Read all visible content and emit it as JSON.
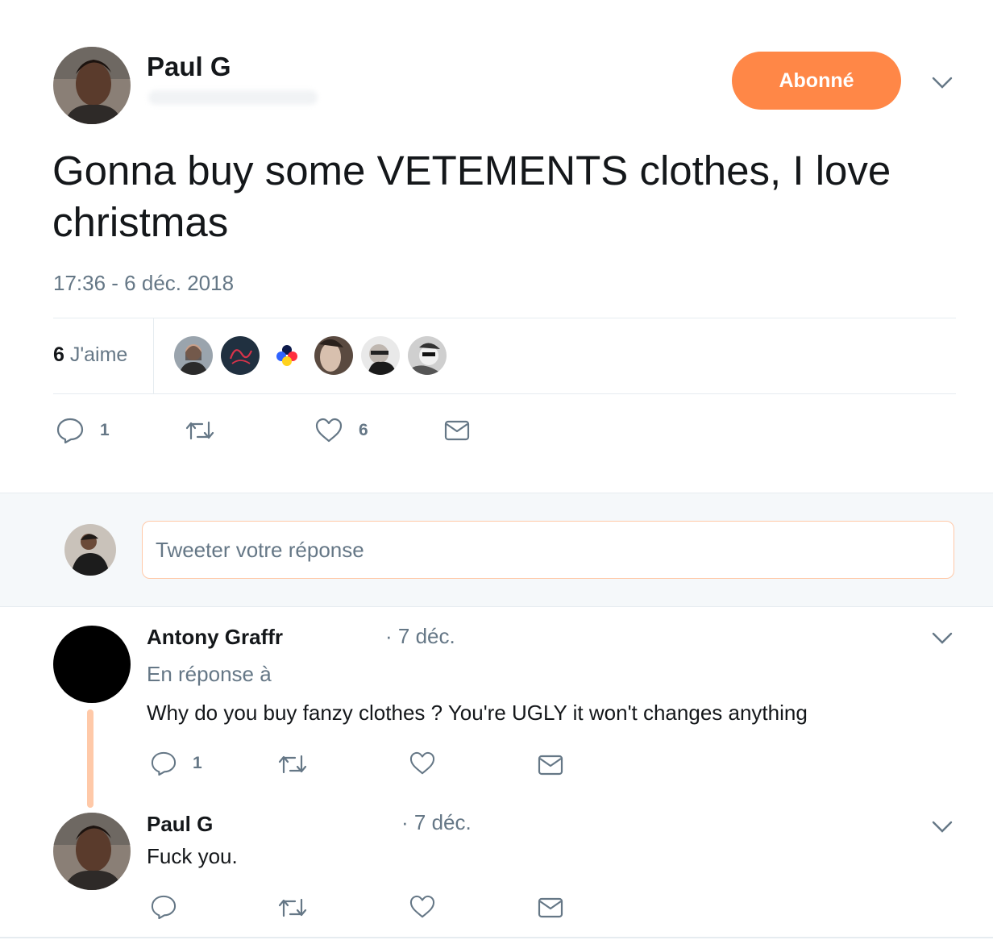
{
  "tweet": {
    "author_name": "Paul G",
    "follow_label": "Abonné",
    "text": "Gonna buy some VETEMENTS clothes, I love christmas",
    "timestamp": "17:36 - 6 déc. 2018",
    "likes_count": "6",
    "likes_label": "J'aime",
    "reply_count": "1",
    "like_count": "6"
  },
  "composer": {
    "placeholder": "Tweeter votre réponse"
  },
  "replies": [
    {
      "author_name": "Antony Graffr",
      "date": "· 7 déc.",
      "in_reply_to": "En réponse à",
      "text": "Why do you buy fanzy clothes ? You're UGLY it won't changes anything",
      "reply_count": "1"
    },
    {
      "author_name": "Paul G",
      "date": "· 7 déc.",
      "text": "Fuck you."
    }
  ],
  "colors": {
    "accent": "#ff8747",
    "thread_line": "#ffc9a8",
    "muted": "#657786",
    "composer_bg": "#f5f8fa"
  }
}
